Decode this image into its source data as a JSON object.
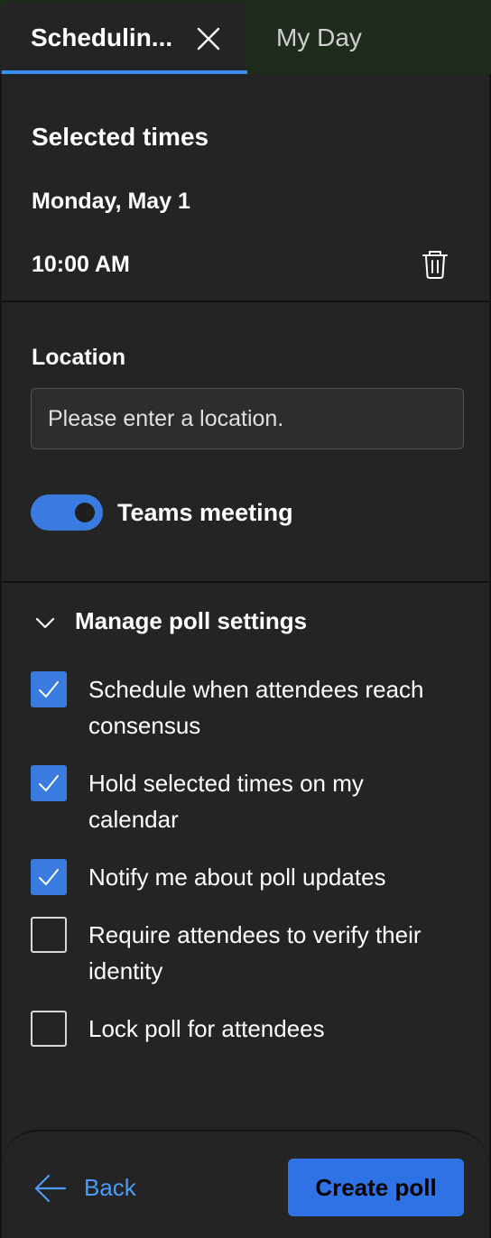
{
  "tabs": {
    "active_label": "Schedulin...",
    "inactive_label": "My Day"
  },
  "selected_times": {
    "title": "Selected times",
    "date": "Monday, May 1",
    "time": "10:00 AM"
  },
  "location": {
    "title": "Location",
    "placeholder": "Please enter a location.",
    "value": ""
  },
  "teams": {
    "label": "Teams meeting",
    "enabled": true
  },
  "poll_settings": {
    "title": "Manage poll settings",
    "expanded": true,
    "options": [
      {
        "label": "Schedule when attendees reach consensus",
        "checked": true
      },
      {
        "label": "Hold selected times on my calendar",
        "checked": true
      },
      {
        "label": "Notify me about poll updates",
        "checked": true
      },
      {
        "label": "Require attendees to verify their identity",
        "checked": false
      },
      {
        "label": "Lock poll for attendees",
        "checked": false
      }
    ]
  },
  "footer": {
    "back_label": "Back",
    "create_label": "Create poll"
  },
  "colors": {
    "accent": "#3a7be0",
    "link": "#4c9bf5",
    "background": "#242424",
    "tab_strip": "#1f2b1c"
  },
  "icons": {
    "close": "close-icon",
    "delete": "trash-icon",
    "expand": "chevron-down-icon",
    "check": "check-icon",
    "back": "arrow-left-icon"
  }
}
